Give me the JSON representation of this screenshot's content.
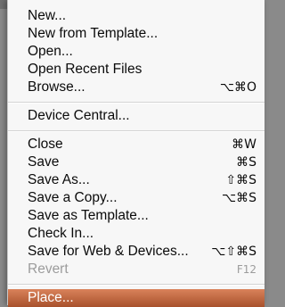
{
  "menu": {
    "group1": [
      {
        "label": "New...",
        "shortcut": ""
      },
      {
        "label": "New from Template...",
        "shortcut": ""
      },
      {
        "label": "Open...",
        "shortcut": ""
      },
      {
        "label": "Open Recent Files",
        "shortcut": ""
      },
      {
        "label": "Browse...",
        "shortcut": "⌥⌘O"
      }
    ],
    "group2": [
      {
        "label": "Device Central...",
        "shortcut": ""
      }
    ],
    "group3": [
      {
        "label": "Close",
        "shortcut": "⌘W"
      },
      {
        "label": "Save",
        "shortcut": "⌘S"
      },
      {
        "label": "Save As...",
        "shortcut": "⇧⌘S"
      },
      {
        "label": "Save a Copy...",
        "shortcut": "⌥⌘S"
      },
      {
        "label": "Save as Template...",
        "shortcut": ""
      },
      {
        "label": "Check In...",
        "shortcut": ""
      },
      {
        "label": "Save for Web & Devices...",
        "shortcut": "⌥⇧⌘S"
      },
      {
        "label": "Revert",
        "shortcut": "F12"
      }
    ],
    "highlighted": {
      "label": "Place...",
      "shortcut": ""
    }
  },
  "colors": {
    "highlight_top": "#d9825a",
    "highlight_bottom": "#a8512c",
    "disabled_text": "#9c9c9c"
  }
}
